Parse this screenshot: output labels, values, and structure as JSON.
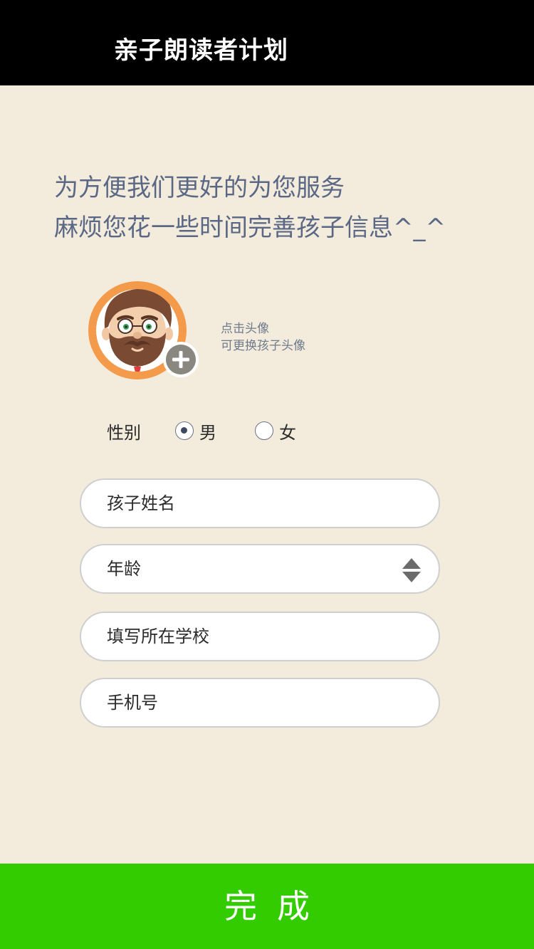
{
  "header": {
    "title": "亲子朗读者计划"
  },
  "intro": {
    "line1": "为方便我们更好的为您服务",
    "line2": "麻烦您花一些时间完善孩子信息^_^"
  },
  "avatar": {
    "hint_line1": "点击头像",
    "hint_line2": "可更换孩子头像",
    "ring_color": "#f39a4b",
    "add_badge_color": "#8a8680"
  },
  "gender": {
    "label": "性别",
    "options": [
      {
        "label": "男",
        "selected": true
      },
      {
        "label": "女",
        "selected": false
      }
    ]
  },
  "form": {
    "name_placeholder": "孩子姓名",
    "age_placeholder": "年龄",
    "school_placeholder": "填写所在学校",
    "phone_placeholder": "手机号"
  },
  "footer": {
    "done_label": "完成",
    "button_color": "#33cc00"
  }
}
